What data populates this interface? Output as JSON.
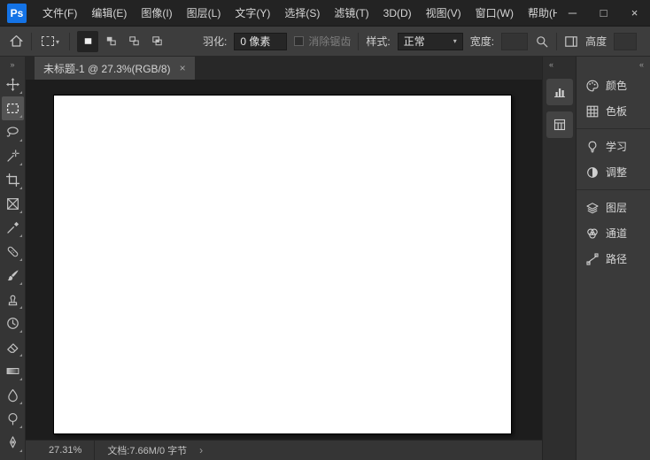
{
  "menubar": {
    "logo": "Ps",
    "items": [
      "文件(F)",
      "编辑(E)",
      "图像(I)",
      "图层(L)",
      "文字(Y)",
      "选择(S)",
      "滤镜(T)",
      "3D(D)",
      "视图(V)",
      "窗口(W)",
      "帮助(H)"
    ],
    "window_controls": {
      "minimize": "─",
      "maximize": "□",
      "close": "×"
    }
  },
  "optionsbar": {
    "tool_preview_icon": "rectangular-marquee",
    "caret": "▾",
    "selection_modes": [
      "new-selection",
      "add-to-selection",
      "subtract-from-selection",
      "intersect-selection"
    ],
    "active_selection_mode": "new-selection",
    "feather_label": "羽化:",
    "feather_value": "0 像素",
    "antialias_label": "消除锯齿",
    "antialias_checked": false,
    "style_label": "样式:",
    "style_value": "正常",
    "width_label": "宽度:",
    "width_value": "",
    "height_label": "高度"
  },
  "toolbar": {
    "expand_chevron": "»",
    "active_tool": "rectangular-marquee",
    "tools": [
      "move",
      "rectangular-marquee",
      "lasso",
      "magic-wand",
      "crop",
      "frame",
      "eyedropper",
      "spot-healing-brush",
      "brush",
      "clone-stamp",
      "history-brush",
      "eraser",
      "gradient",
      "blur",
      "dodge",
      "pen"
    ]
  },
  "document": {
    "tab_title": "未标题-1 @ 27.3%(RGB/8)",
    "tab_close": "×",
    "canvas_color": "#ffffff"
  },
  "right_dock": {
    "collapse_chevron": "«",
    "collapsed_icons": [
      "histogram",
      "library"
    ],
    "panels": [
      {
        "icon": "palette",
        "label": "颜色"
      },
      {
        "icon": "swatches-grid",
        "label": "色板"
      },
      {
        "icon": "lightbulb",
        "label": "学习"
      },
      {
        "icon": "half-circle",
        "label": "调整"
      },
      {
        "icon": "layers",
        "label": "图层"
      },
      {
        "icon": "channels",
        "label": "通道"
      },
      {
        "icon": "path",
        "label": "路径"
      }
    ]
  },
  "statusbar": {
    "zoom": "27.31%",
    "document_info": "文档:7.66M/0 字节",
    "chevron": "›"
  },
  "colors": {
    "accent_blue": "#1473e6",
    "ui_dark": "#232323",
    "panel": "#3a3a3a",
    "pasteboard": "#1d1d1d"
  }
}
